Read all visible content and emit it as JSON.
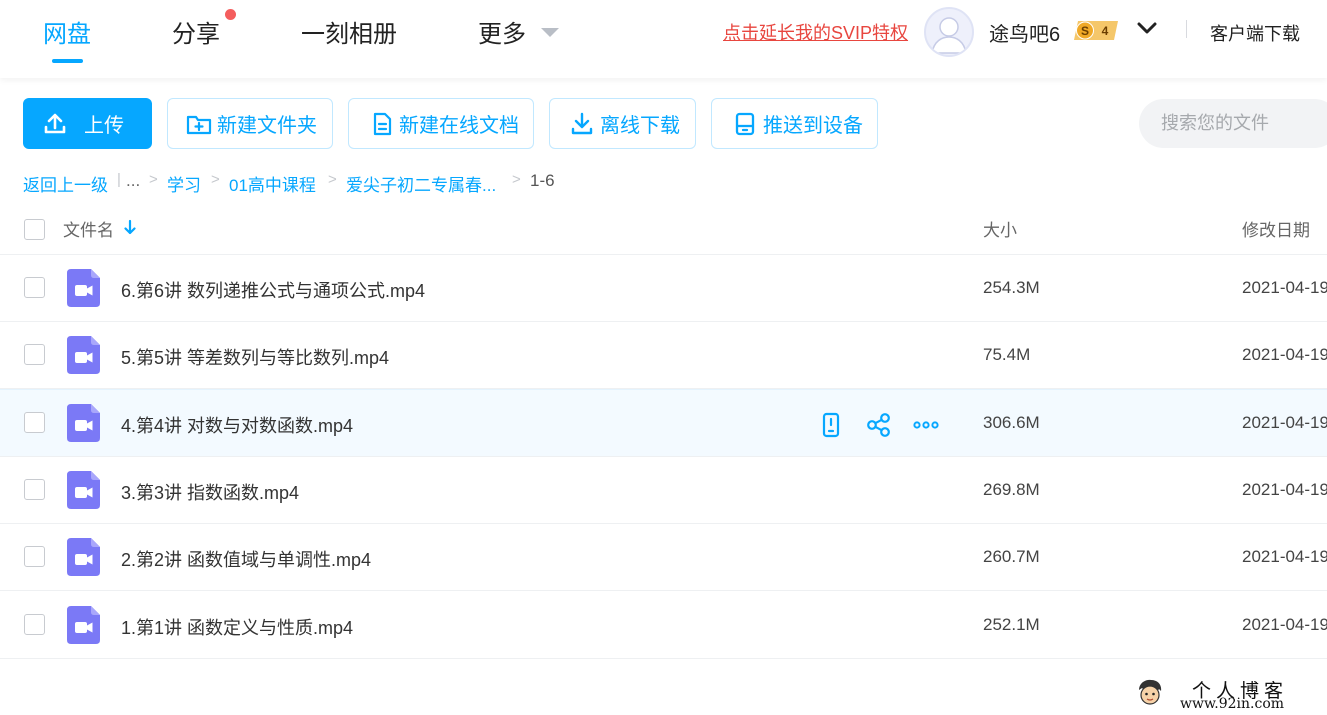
{
  "nav": {
    "items": [
      "网盘",
      "分享",
      "一刻相册",
      "更多"
    ],
    "svip_link": "点击延长我的SVIP特权",
    "username": "途鸟吧6",
    "vip_level": "4",
    "vip_badge_letter": "S",
    "client_download": "客户端下载"
  },
  "toolbar": {
    "upload": "上传",
    "new_folder": "新建文件夹",
    "new_doc": "新建在线文档",
    "offline_download": "离线下载",
    "push_device": "推送到设备",
    "search_placeholder": "搜索您的文件"
  },
  "breadcrumb": {
    "back": "返回上一级",
    "ellipsis": "...",
    "items": [
      "学习",
      "01高中课程",
      "爱尖子初二专属春..."
    ],
    "current": "1-6"
  },
  "table": {
    "headers": {
      "name": "文件名",
      "size": "大小",
      "date": "修改日期"
    },
    "rows": [
      {
        "name": "6.第6讲 数列递推公式与通项公式.mp4",
        "size": "254.3M",
        "date": "2021-04-19"
      },
      {
        "name": "5.第5讲 等差数列与等比数列.mp4",
        "size": "75.4M",
        "date": "2021-04-19"
      },
      {
        "name": "4.第4讲 对数与对数函数.mp4",
        "size": "306.6M",
        "date": "2021-04-19"
      },
      {
        "name": "3.第3讲 指数函数.mp4",
        "size": "269.8M",
        "date": "2021-04-19"
      },
      {
        "name": "2.第2讲 函数值域与单调性.mp4",
        "size": "260.7M",
        "date": "2021-04-19"
      },
      {
        "name": "1.第1讲 函数定义与性质.mp4",
        "size": "252.1M",
        "date": "2021-04-19"
      }
    ]
  },
  "watermark": {
    "line1": "个人博客",
    "line2": "www.92in.com"
  },
  "colors": {
    "accent": "#06a7ff",
    "svip": "#e8463f",
    "video_icon": "#7b79f6",
    "badge": "#f5b94a"
  }
}
